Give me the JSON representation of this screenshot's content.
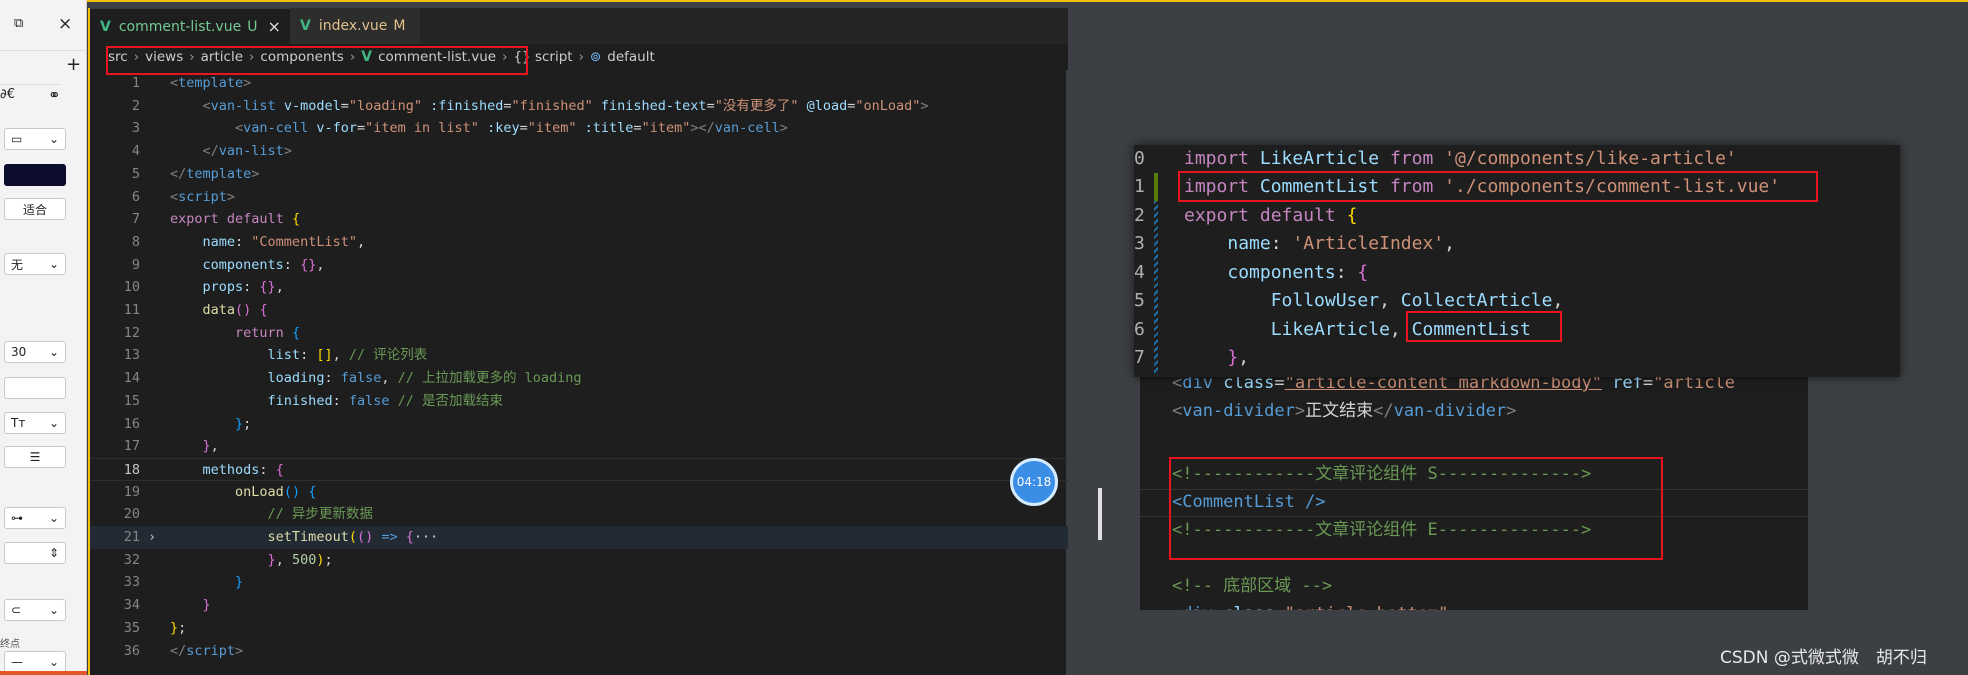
{
  "leftbar": {
    "close_glyph": "×",
    "restore_glyph": "⧉",
    "plus_glyph": "+",
    "fit_label": "适合",
    "none_label": "无",
    "size_value": "30",
    "endpoint_label": "终点"
  },
  "tabs": [
    {
      "name": "comment-list.vue",
      "status": "U",
      "close": "×"
    },
    {
      "name": "index.vue",
      "status": "M"
    }
  ],
  "breadcrumb": [
    "src",
    "views",
    "article",
    "components",
    "comment-list.vue",
    "{} script",
    "default"
  ],
  "code_lines": [
    {
      "n": "1"
    },
    {
      "n": "2"
    },
    {
      "n": "3"
    },
    {
      "n": "4"
    },
    {
      "n": "5"
    },
    {
      "n": "6"
    },
    {
      "n": "7"
    },
    {
      "n": "8"
    },
    {
      "n": "9"
    },
    {
      "n": "10"
    },
    {
      "n": "11"
    },
    {
      "n": "12"
    },
    {
      "n": "13"
    },
    {
      "n": "14"
    },
    {
      "n": "15"
    },
    {
      "n": "16"
    },
    {
      "n": "17"
    },
    {
      "n": "18"
    },
    {
      "n": "19"
    },
    {
      "n": "20"
    },
    {
      "n": "21"
    },
    {
      "n": "32"
    },
    {
      "n": "33"
    },
    {
      "n": "34"
    },
    {
      "n": "35"
    },
    {
      "n": "36"
    }
  ],
  "code_text": {
    "l2_finished_text": "没有更多了",
    "l13_comment": "// 评论列表",
    "l14_comment": "// 上拉加载更多的 loading",
    "l15_comment": "// 是否加载结束",
    "l20_comment": "// 异步更新数据",
    "name_value": "\"CommentList\"",
    "timeout_value": "500"
  },
  "timer": "04:18",
  "snippet1": {
    "line_numbers": [
      "0",
      "1",
      "2",
      "3",
      "4",
      "5",
      "6",
      "7"
    ],
    "import_like": "'@/components/like-article'",
    "import_comment": "'./components/comment-list.vue'",
    "name_value": "'ArticleIndex'"
  },
  "snippet2": {
    "divider_text": "正文结束",
    "comment_start": "<!------------文章评论组件 S-------------->",
    "component_tag": "<CommentList />",
    "comment_end": "<!------------文章评论组件 E-------------->",
    "footer_comment": "<!-- 底部区域 -->"
  },
  "watermark": "CSDN @式微式微　胡不归",
  "colors": {
    "accent_yellow": "#f2c200",
    "highlight_red": "#e8141e",
    "vue_green": "#41b883"
  }
}
